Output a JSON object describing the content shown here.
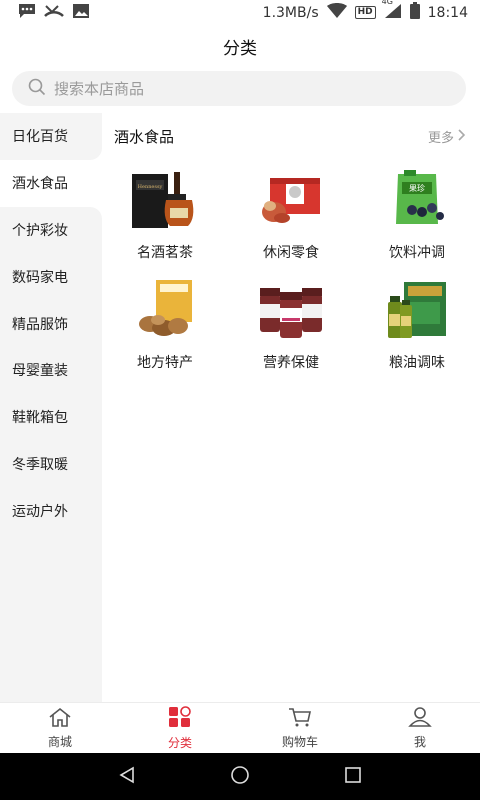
{
  "status_bar": {
    "net_speed": "1.3MB/s",
    "hd": "HD",
    "network": "4G",
    "time": "18:14"
  },
  "header": {
    "title": "分类"
  },
  "search": {
    "placeholder": "搜索本店商品"
  },
  "sidebar": {
    "items": [
      {
        "label": "日化百货"
      },
      {
        "label": "酒水食品"
      },
      {
        "label": "个护彩妆"
      },
      {
        "label": "数码家电"
      },
      {
        "label": "精品服饰"
      },
      {
        "label": "母婴童装"
      },
      {
        "label": "鞋靴箱包"
      },
      {
        "label": "冬季取暖"
      },
      {
        "label": "运动户外"
      }
    ],
    "active_index": 1
  },
  "section": {
    "title": "酒水食品",
    "more": "更多",
    "items": [
      {
        "label": "名酒茗茶",
        "icon": "liquor-bottle-image"
      },
      {
        "label": "休闲零食",
        "icon": "snack-box-image"
      },
      {
        "label": "饮料冲调",
        "icon": "drink-pouch-image"
      },
      {
        "label": "地方特产",
        "icon": "specialty-bag-image"
      },
      {
        "label": "营养保健",
        "icon": "supplement-bottles-image"
      },
      {
        "label": "粮油调味",
        "icon": "oil-bottles-image"
      }
    ]
  },
  "tab_bar": {
    "tabs": [
      {
        "label": "商城",
        "icon": "home-icon"
      },
      {
        "label": "分类",
        "icon": "category-icon"
      },
      {
        "label": "购物车",
        "icon": "cart-icon"
      },
      {
        "label": "我",
        "icon": "user-icon"
      }
    ],
    "active_index": 1
  },
  "colors": {
    "accent": "#e02e3b",
    "sidebar_bg": "#f4f4f4",
    "nav_bg": "#000000"
  }
}
